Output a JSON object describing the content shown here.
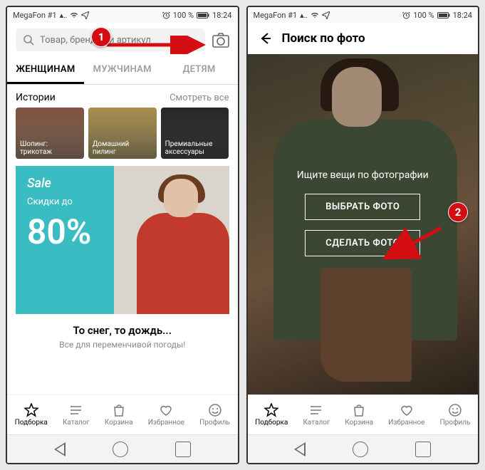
{
  "statusbar": {
    "carrier": "MegaFon #1",
    "battery": "100 %",
    "time": "18:24"
  },
  "search": {
    "placeholder": "Товар, бренд или артикул"
  },
  "tabs": {
    "women": "ЖЕНЩИНАМ",
    "men": "МУЖЧИНАМ",
    "kids": "ДЕТЯМ"
  },
  "stories": {
    "title": "Истории",
    "seeall": "Смотреть все",
    "items": [
      "Шопинг: трикотаж",
      "Домашний пилинг",
      "Премиальные аксессуары"
    ]
  },
  "sale": {
    "title": "Sale",
    "sub": "Скидки до",
    "num": "80%"
  },
  "promo": {
    "title": "То снег, то дождь...",
    "sub": "Все для переменчивой погоды!"
  },
  "nav": {
    "feed": "Подборка",
    "catalog": "Каталог",
    "cart": "Корзина",
    "fav": "Избранное",
    "profile": "Профиль"
  },
  "photo": {
    "header": "Поиск по фото",
    "hint": "Ищите вещи по фотографии",
    "choose": "ВЫБРАТЬ ФОТО",
    "take": "СДЕЛАТЬ ФОТО"
  },
  "callouts": {
    "one": "1",
    "two": "2"
  }
}
